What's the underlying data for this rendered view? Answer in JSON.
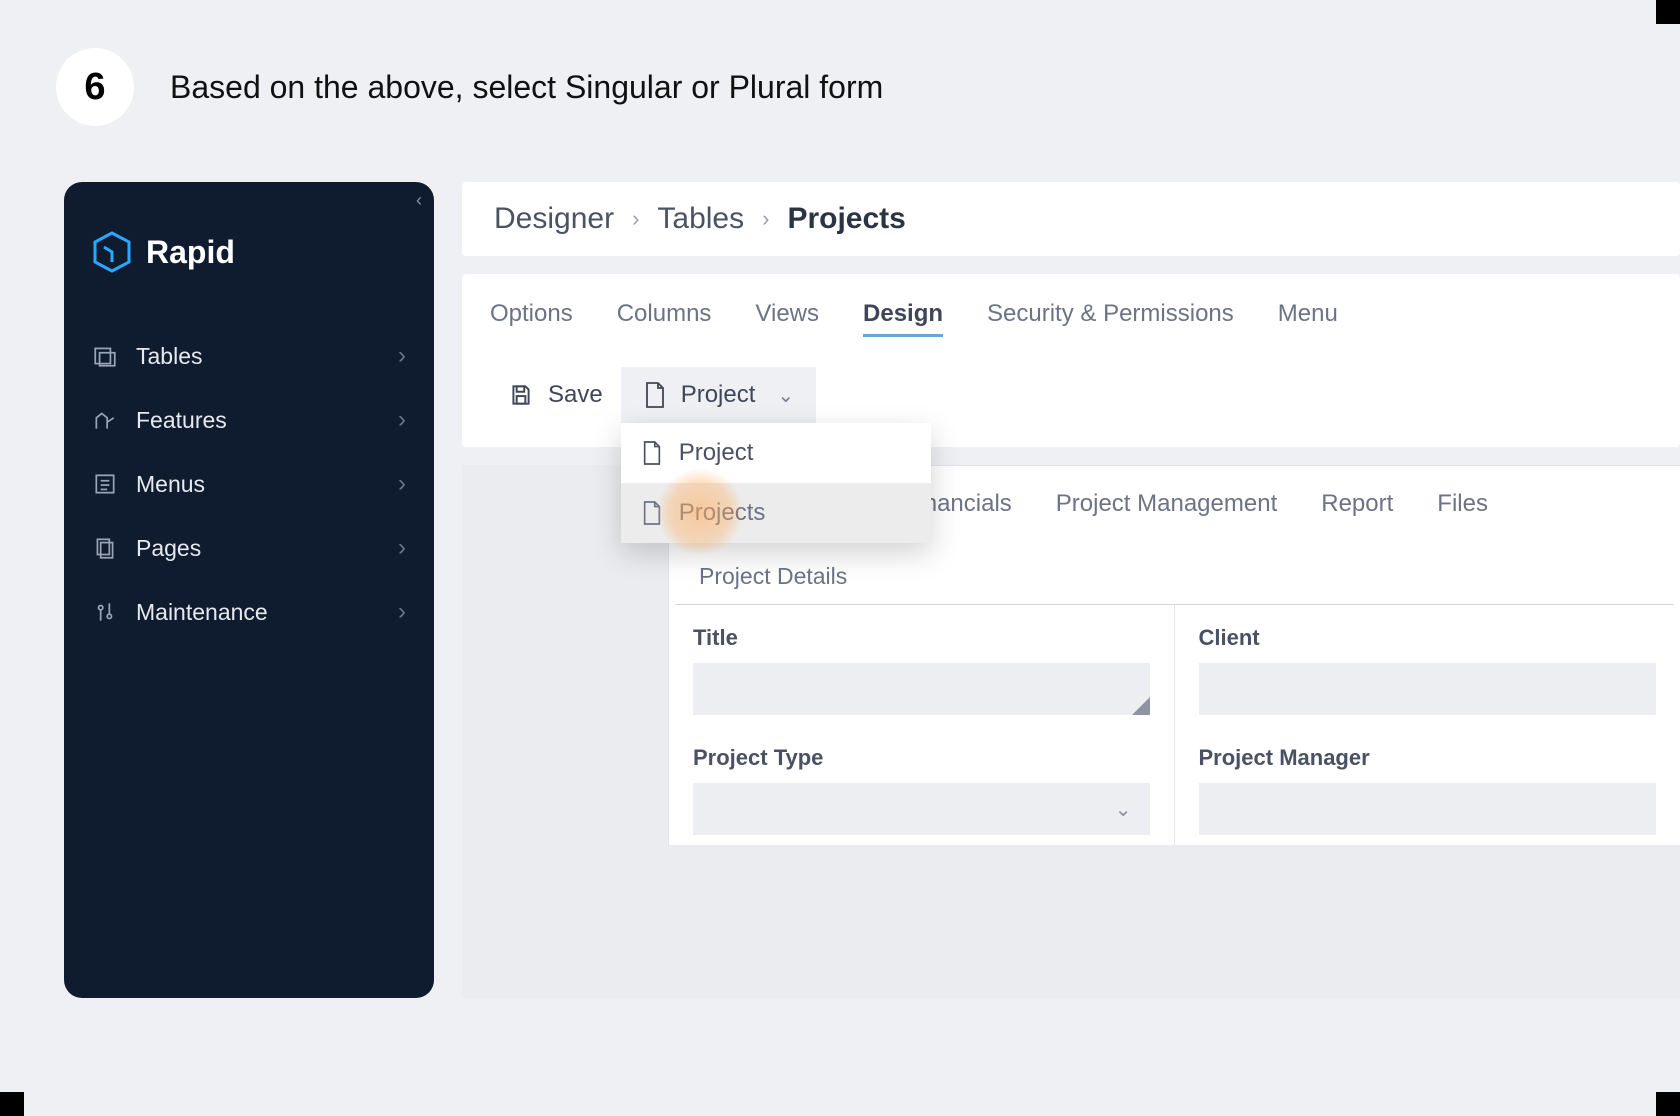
{
  "step": {
    "number": "6",
    "text": "Based on the above, select Singular or Plural form"
  },
  "brand": {
    "name": "Rapid"
  },
  "sidebar": {
    "items": [
      {
        "label": "Tables"
      },
      {
        "label": "Features"
      },
      {
        "label": "Menus"
      },
      {
        "label": "Pages"
      },
      {
        "label": "Maintenance"
      }
    ]
  },
  "breadcrumb": {
    "root": "Designer",
    "mid": "Tables",
    "current": "Projects"
  },
  "tabs": {
    "items": [
      {
        "label": "Options"
      },
      {
        "label": "Columns"
      },
      {
        "label": "Views"
      },
      {
        "label": "Design"
      },
      {
        "label": "Security & Permissions"
      },
      {
        "label": "Menu"
      }
    ],
    "active_index": 3
  },
  "toolbar": {
    "save_label": "Save",
    "form_selector": {
      "value": "Project",
      "options": [
        {
          "label": "Project"
        },
        {
          "label": "Projects"
        }
      ]
    }
  },
  "design_panel": {
    "tabs": [
      {
        "label": "Project Details"
      },
      {
        "label": "Financials"
      },
      {
        "label": "Project Management"
      },
      {
        "label": "Report"
      },
      {
        "label": "Files"
      }
    ],
    "active_index": 0,
    "section_title": "Project Details",
    "fields": [
      {
        "label": "Title",
        "type": "text"
      },
      {
        "label": "Client",
        "type": "text"
      },
      {
        "label": "Project Type",
        "type": "select"
      },
      {
        "label": "Project Manager",
        "type": "text"
      }
    ]
  }
}
